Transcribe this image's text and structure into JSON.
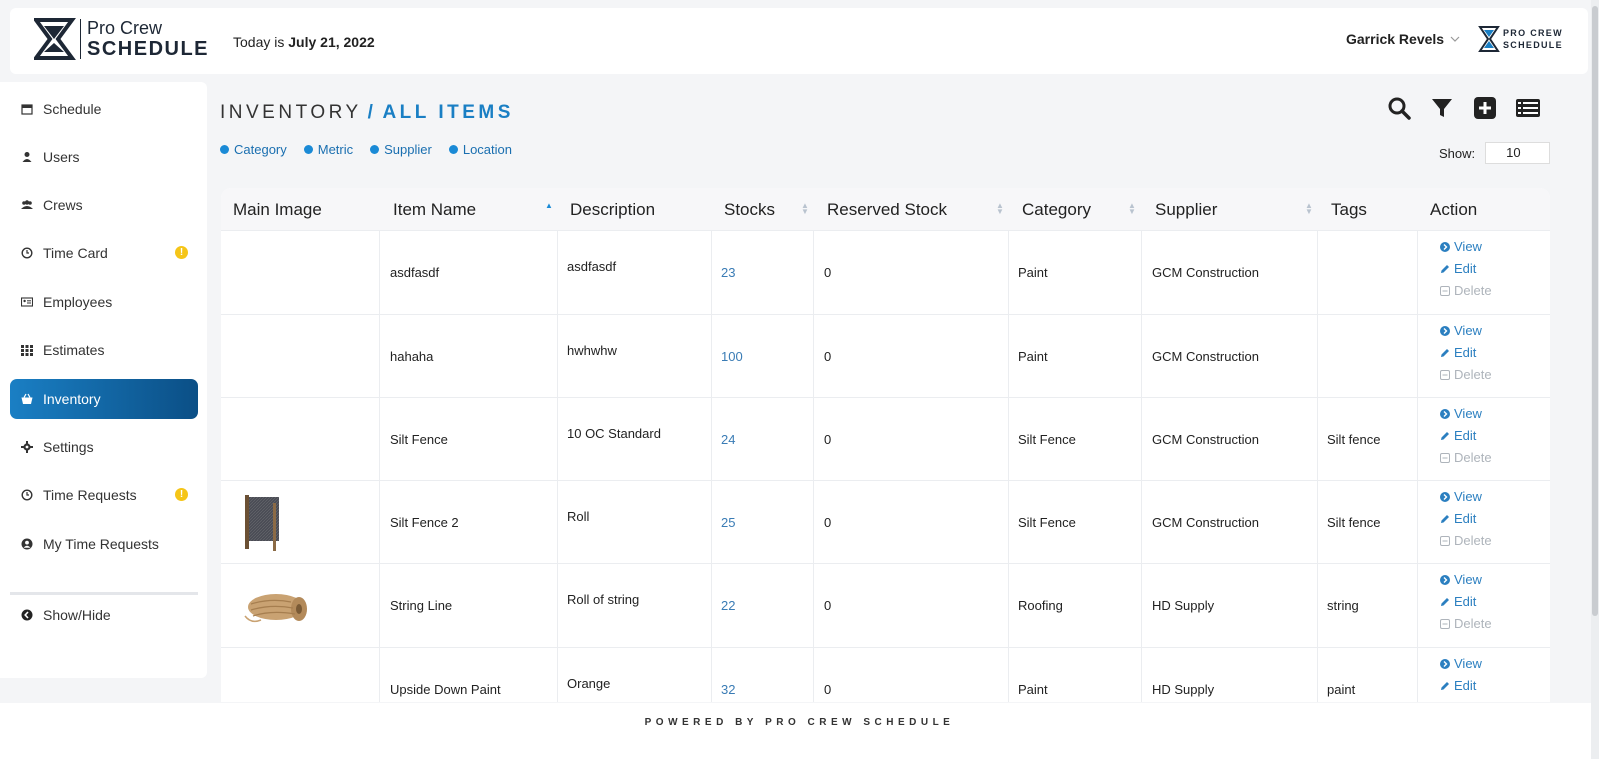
{
  "header": {
    "logo_line1": "Pro Crew",
    "logo_line2": "SCHEDULE",
    "today_prefix": "Today is ",
    "today_date": "July 21, 2022",
    "user_name": "Garrick Revels",
    "small_logo_line1": "PRO CREW",
    "small_logo_line2": "SCHEDULE"
  },
  "sidebar": {
    "items": [
      {
        "label": "Schedule",
        "icon": "calendar-icon"
      },
      {
        "label": "Users",
        "icon": "user-icon"
      },
      {
        "label": "Crews",
        "icon": "users-icon"
      },
      {
        "label": "Time Card",
        "icon": "clock-icon",
        "badge": "!"
      },
      {
        "label": "Employees",
        "icon": "id-card-icon"
      },
      {
        "label": "Estimates",
        "icon": "grid-icon"
      },
      {
        "label": "Inventory",
        "icon": "basket-icon",
        "active": true
      },
      {
        "label": "Settings",
        "icon": "gear-icon"
      },
      {
        "label": "Time Requests",
        "icon": "clock-icon",
        "badge": "!"
      },
      {
        "label": "My Time Requests",
        "icon": "user-circle-icon"
      }
    ],
    "toggle_label": "Show/Hide"
  },
  "main": {
    "title": "INVENTORY",
    "title_sep": "/",
    "subtitle": "ALL ITEMS",
    "filters": [
      "Category",
      "Metric",
      "Supplier",
      "Location"
    ],
    "show_label": "Show:",
    "show_value": "10"
  },
  "table": {
    "columns": [
      "Main Image",
      "Item Name",
      "Description",
      "Stocks",
      "Reserved Stock",
      "Category",
      "Supplier",
      "Tags",
      "Action"
    ],
    "rows": [
      {
        "image": "",
        "name": "asdfasdf",
        "description": "asdfasdf",
        "stocks": "23",
        "reserved": "0",
        "category": "Paint",
        "supplier": "GCM Construction",
        "tags": ""
      },
      {
        "image": "",
        "name": "hahaha",
        "description": "hwhwhw",
        "stocks": "100",
        "reserved": "0",
        "category": "Paint",
        "supplier": "GCM Construction",
        "tags": ""
      },
      {
        "image": "",
        "name": "Silt Fence",
        "description": "10 OC Standard",
        "stocks": "24",
        "reserved": "0",
        "category": "Silt Fence",
        "supplier": "GCM Construction",
        "tags": "Silt fence"
      },
      {
        "image": "silt-fence-roll",
        "name": "Silt Fence 2",
        "description": "Roll",
        "stocks": "25",
        "reserved": "0",
        "category": "Silt Fence",
        "supplier": "GCM Construction",
        "tags": "Silt fence"
      },
      {
        "image": "string-roll",
        "name": "String Line",
        "description": "Roll of string",
        "stocks": "22",
        "reserved": "0",
        "category": "Roofing",
        "supplier": "HD Supply",
        "tags": "string"
      },
      {
        "image": "",
        "name": "Upside Down Paint",
        "description": "Orange",
        "stocks": "32",
        "reserved": "0",
        "category": "Paint",
        "supplier": "HD Supply",
        "tags": "paint"
      }
    ],
    "actions": {
      "view": "View",
      "edit": "Edit",
      "delete": "Delete"
    }
  },
  "footer": {
    "text": "POWERED BY PRO CREW SCHEDULE"
  },
  "colors": {
    "accent": "#1a7fc4",
    "active_nav_start": "#1a7fc4",
    "active_nav_end": "#0b4f86",
    "badge": "#f5c518"
  }
}
